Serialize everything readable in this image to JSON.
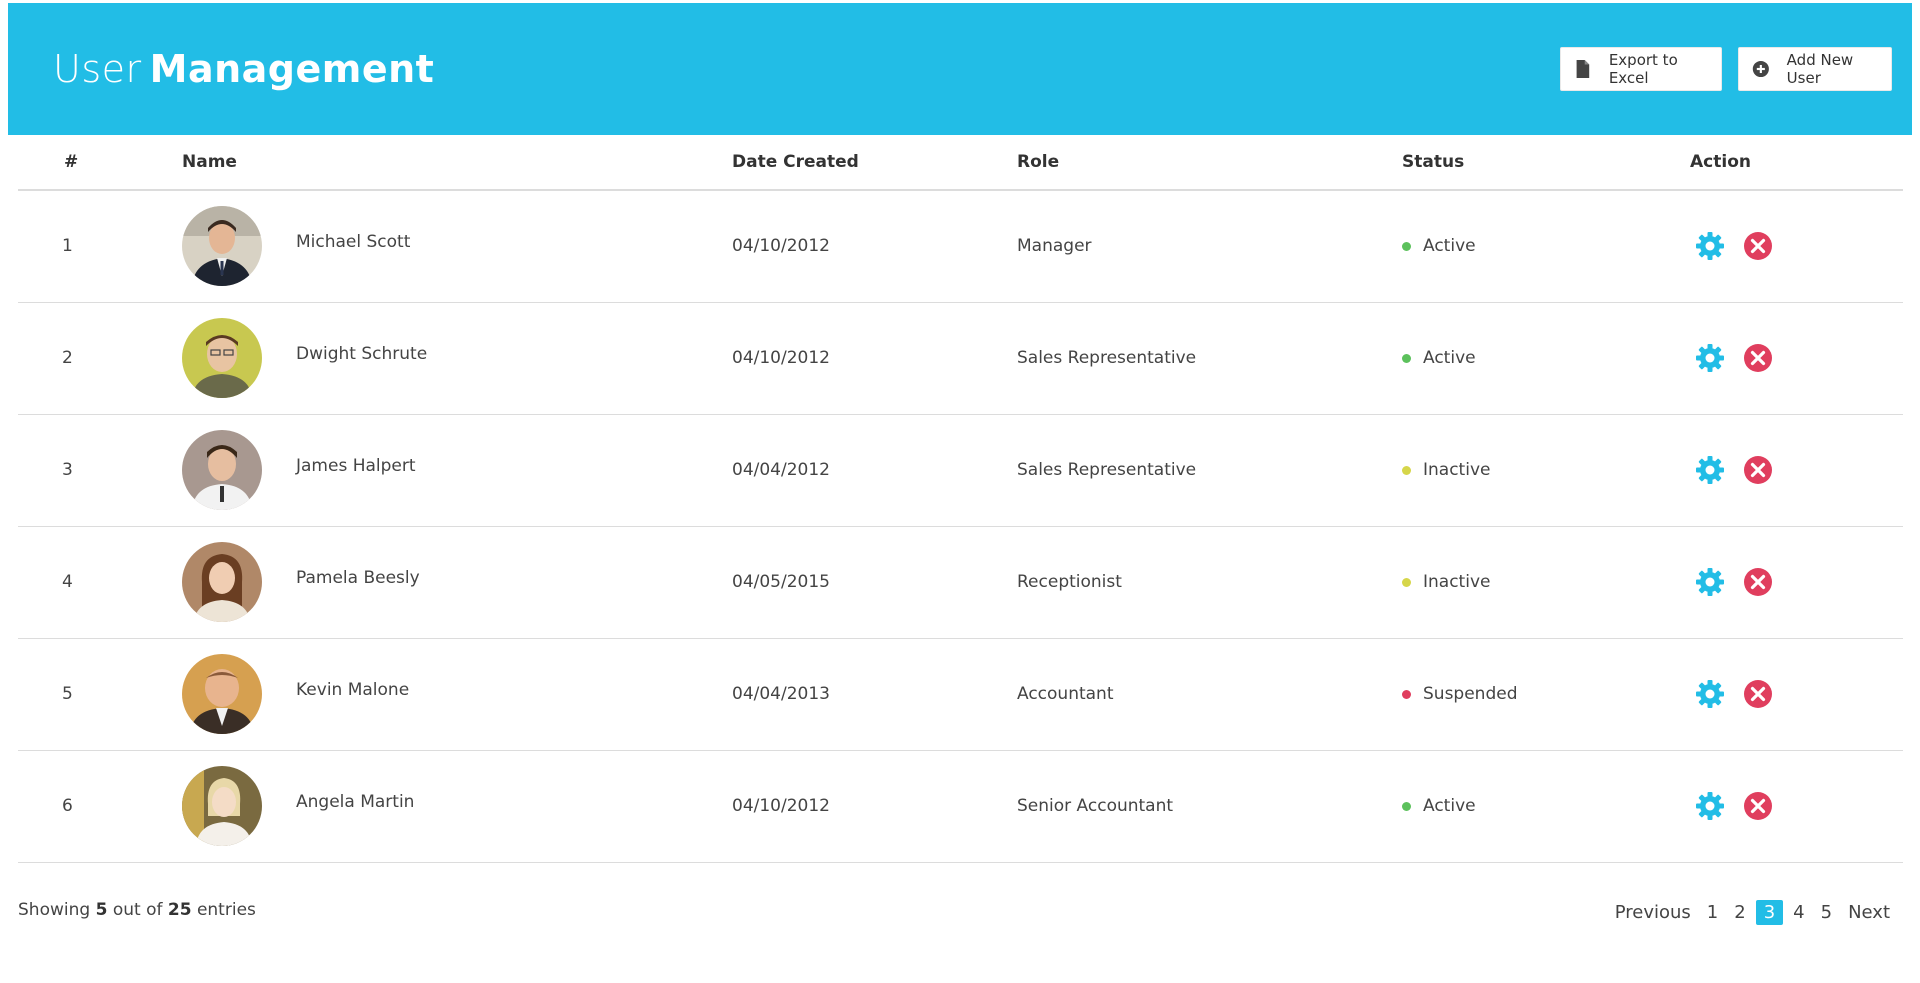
{
  "header": {
    "title_light": "User",
    "title_bold": "Management",
    "export_label": "Export to Excel",
    "add_label": "Add New User"
  },
  "table": {
    "columns": [
      "#",
      "Name",
      "Date Created",
      "Role",
      "Status",
      "Action"
    ],
    "rows": [
      {
        "num": "1",
        "name": "Michael Scott",
        "date": "04/10/2012",
        "role": "Manager",
        "status": "Active",
        "status_color": "#5cc15c"
      },
      {
        "num": "2",
        "name": "Dwight Schrute",
        "date": "04/10/2012",
        "role": "Sales Representative",
        "status": "Active",
        "status_color": "#5cc15c"
      },
      {
        "num": "3",
        "name": "James Halpert",
        "date": "04/04/2012",
        "role": "Sales Representative",
        "status": "Inactive",
        "status_color": "#d6d64a"
      },
      {
        "num": "4",
        "name": "Pamela Beesly",
        "date": "04/05/2015",
        "role": "Receptionist",
        "status": "Inactive",
        "status_color": "#d6d64a"
      },
      {
        "num": "5",
        "name": "Kevin Malone",
        "date": "04/04/2013",
        "role": "Accountant",
        "status": "Suspended",
        "status_color": "#e03e5e"
      },
      {
        "num": "6",
        "name": "Angela Martin",
        "date": "04/10/2012",
        "role": "Senior Accountant",
        "status": "Active",
        "status_color": "#5cc15c"
      }
    ]
  },
  "footer": {
    "showing_prefix": "Showing",
    "shown": "5",
    "middle": "out of",
    "total": "25",
    "suffix": "entries"
  },
  "pagination": {
    "previous": "Previous",
    "pages": [
      "1",
      "2",
      "3",
      "4",
      "5"
    ],
    "active_page": "3",
    "next": "Next"
  },
  "colors": {
    "accent": "#22bde6",
    "danger": "#e03e5e",
    "active": "#5cc15c",
    "inactive": "#d6d64a"
  },
  "icons": {
    "export": "file-icon",
    "add": "plus-circle-icon",
    "settings": "gear-icon",
    "delete": "close-circle-icon"
  }
}
